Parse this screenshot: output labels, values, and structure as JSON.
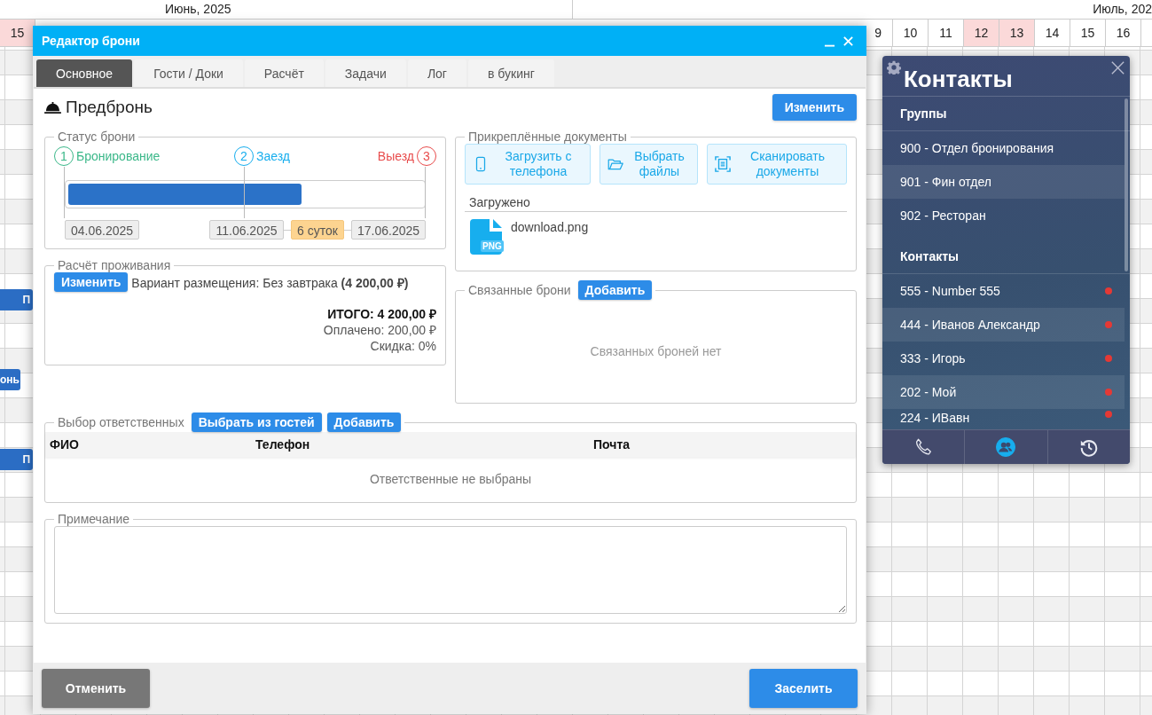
{
  "calendar": {
    "months": [
      "Июнь, 2025",
      "Июль, 202"
    ],
    "days_left": [
      {
        "day": "15",
        "weekend": true
      }
    ],
    "days_right": [
      {
        "day": "9",
        "weekend": false
      },
      {
        "day": "10",
        "weekend": false
      },
      {
        "day": "11",
        "weekend": false
      },
      {
        "day": "12",
        "weekend": true
      },
      {
        "day": "13",
        "weekend": true
      },
      {
        "day": "14",
        "weekend": false
      },
      {
        "day": "15",
        "weekend": false
      },
      {
        "day": "16",
        "weekend": false
      }
    ],
    "bookings": [
      {
        "label": "П"
      },
      {
        "label": "онь"
      },
      {
        "label": "П"
      }
    ]
  },
  "dialog": {
    "title": "Редактор брони",
    "tabs": [
      {
        "label": "Основное",
        "selected": true
      },
      {
        "label": "Гости / Доки",
        "selected": false
      },
      {
        "label": "Расчёт",
        "selected": false
      },
      {
        "label": "Задачи",
        "selected": false
      },
      {
        "label": "Лог",
        "selected": false
      },
      {
        "label": "в букинг",
        "selected": false
      }
    ],
    "status_title": "Предбронь",
    "edit_button": "Изменить",
    "booking_status": {
      "legend": "Статус брони",
      "steps": [
        {
          "number": "1",
          "label": "Бронирование",
          "color": "#3cb88a"
        },
        {
          "number": "2",
          "label": "Заезд",
          "color": "#17aeee"
        },
        {
          "number": "3",
          "label": "Выезд",
          "color": "#e84c4c"
        }
      ],
      "level": 0.66,
      "dates": {
        "start": "04.06.2025",
        "checkin": "11.06.2025",
        "nights": "6 суток",
        "checkout": "17.06.2025"
      }
    },
    "accommodation": {
      "legend": "Расчёт проживания",
      "edit_button": "Изменить",
      "rate": "Вариант размещения: Без завтрака **(4 200,00 ₽)**",
      "total": "ИТОГО: 4 200,00 ₽",
      "paid": "Оплачено: 200,00 ₽",
      "discount": "Скидка: 0%"
    },
    "documents": {
      "legend": "Прикреплённые документы",
      "buttons": [
        {
          "kind": "phone",
          "label": "Загрузить с телефона"
        },
        {
          "kind": "folder",
          "label": "Выбрать файлы"
        },
        {
          "kind": "scan",
          "label": "Сканировать документы"
        }
      ],
      "uploaded_title": "Загружено",
      "files": [
        {
          "name": "download.png",
          "type": "PNG"
        }
      ]
    },
    "linked": {
      "legend": "Связанные брони",
      "add_button": "Добавить",
      "empty": "Связанных броней нет"
    },
    "responsible": {
      "legend": "Выбор ответственных",
      "buttons": [
        "Выбрать из гостей",
        "Добавить"
      ],
      "columns": [
        "ФИО",
        "Телефон",
        "Почта"
      ],
      "empty": "Ответственные не выбраны"
    },
    "note": {
      "legend": "Примечание"
    },
    "footer": {
      "cancel": "Отменить",
      "confirm": "Заселить"
    }
  },
  "contacts": {
    "title": "Контакты",
    "sections": [
      {
        "title": "Группы",
        "items": [
          {
            "label": "900 - Отдел бронирования"
          },
          {
            "label": "901 - Фин отдел"
          },
          {
            "label": "902 - Ресторан"
          }
        ]
      },
      {
        "title": "Контакты",
        "items": [
          {
            "label": "555 - Number 555",
            "online": false
          },
          {
            "label": "444 - Иванов Александр",
            "online": false
          },
          {
            "label": "333 - Игорь",
            "online": false
          },
          {
            "label": "202 - Мой",
            "online": false
          },
          {
            "label": "224 - ИВавн",
            "online": false
          }
        ]
      }
    ],
    "tabs": [
      {
        "kind": "phone",
        "selected": false
      },
      {
        "kind": "contacts",
        "selected": true
      },
      {
        "kind": "history",
        "selected": false
      }
    ]
  }
}
